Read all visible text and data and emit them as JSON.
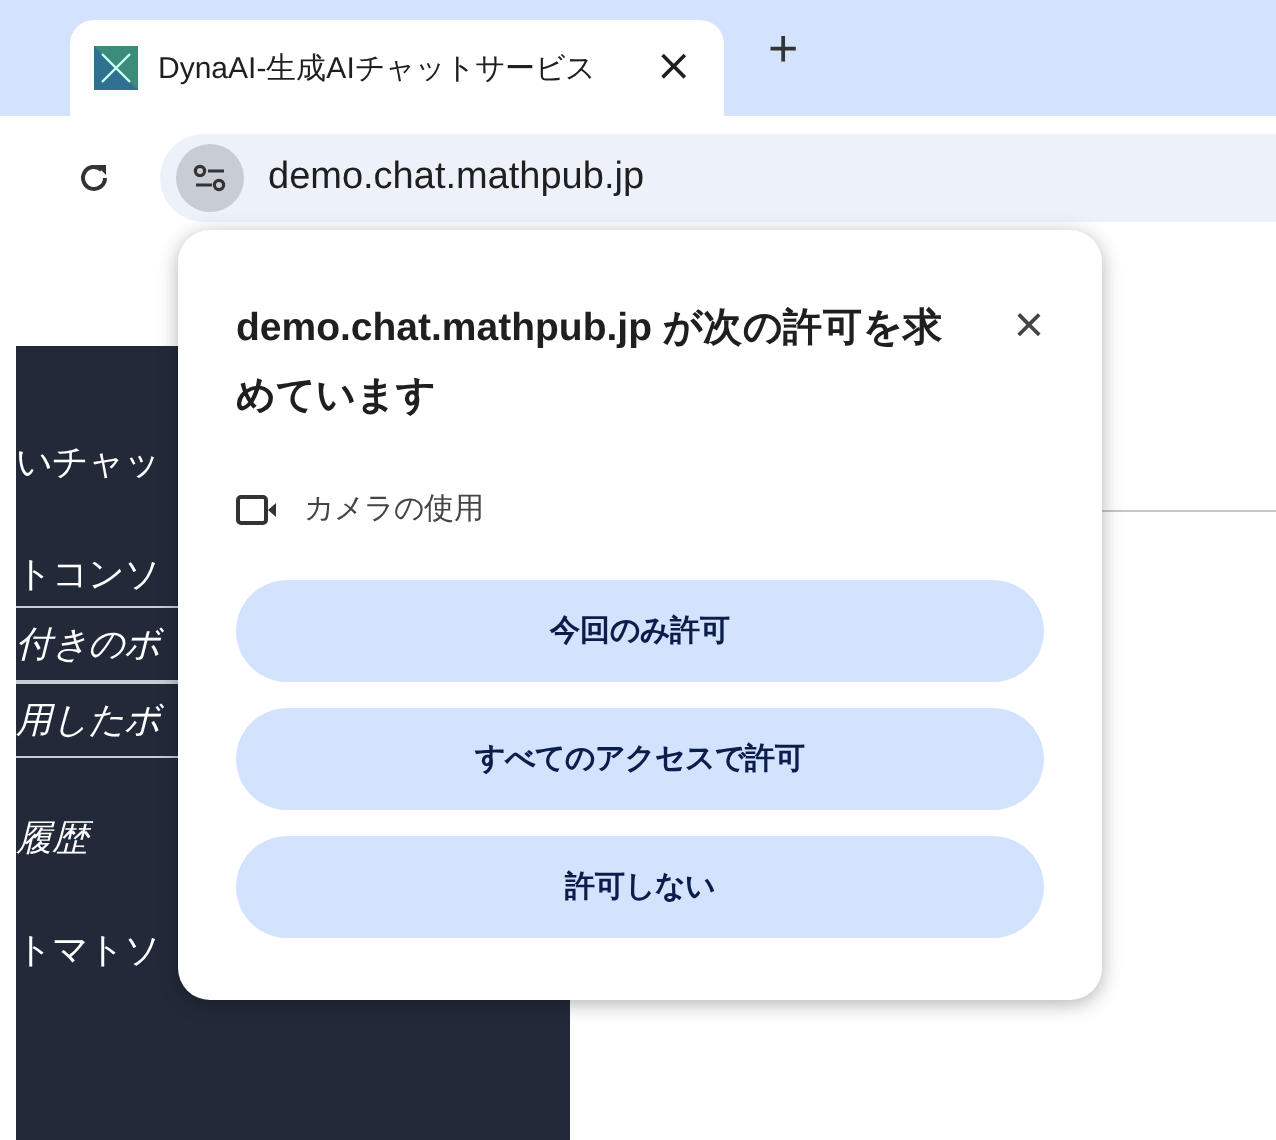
{
  "tab": {
    "title": "DynaAI-生成AIチャットサービス",
    "close": "×",
    "new_tab": "+"
  },
  "address_bar": {
    "url": "demo.chat.mathpub.jp"
  },
  "sidebar": {
    "items": [
      {
        "label": "いチャッ",
        "italic": false,
        "divider": false
      },
      {
        "label": "トコンソ",
        "italic": false,
        "divider": false
      },
      {
        "label": "付きのボ",
        "italic": true,
        "divider": true
      },
      {
        "label": "用したボ",
        "italic": true,
        "divider": true
      },
      {
        "label": "履歴",
        "italic": true,
        "divider": false
      },
      {
        "label": "トマトソ",
        "italic": false,
        "divider": false
      }
    ]
  },
  "permission_popup": {
    "title": "**demo.chat.mathpub.jp** が次の許可を求めています",
    "close": "×",
    "permission": "カメラの使用",
    "buttons": [
      "今回のみ許可",
      "すべてのアクセスで許可",
      "許可しない"
    ]
  }
}
